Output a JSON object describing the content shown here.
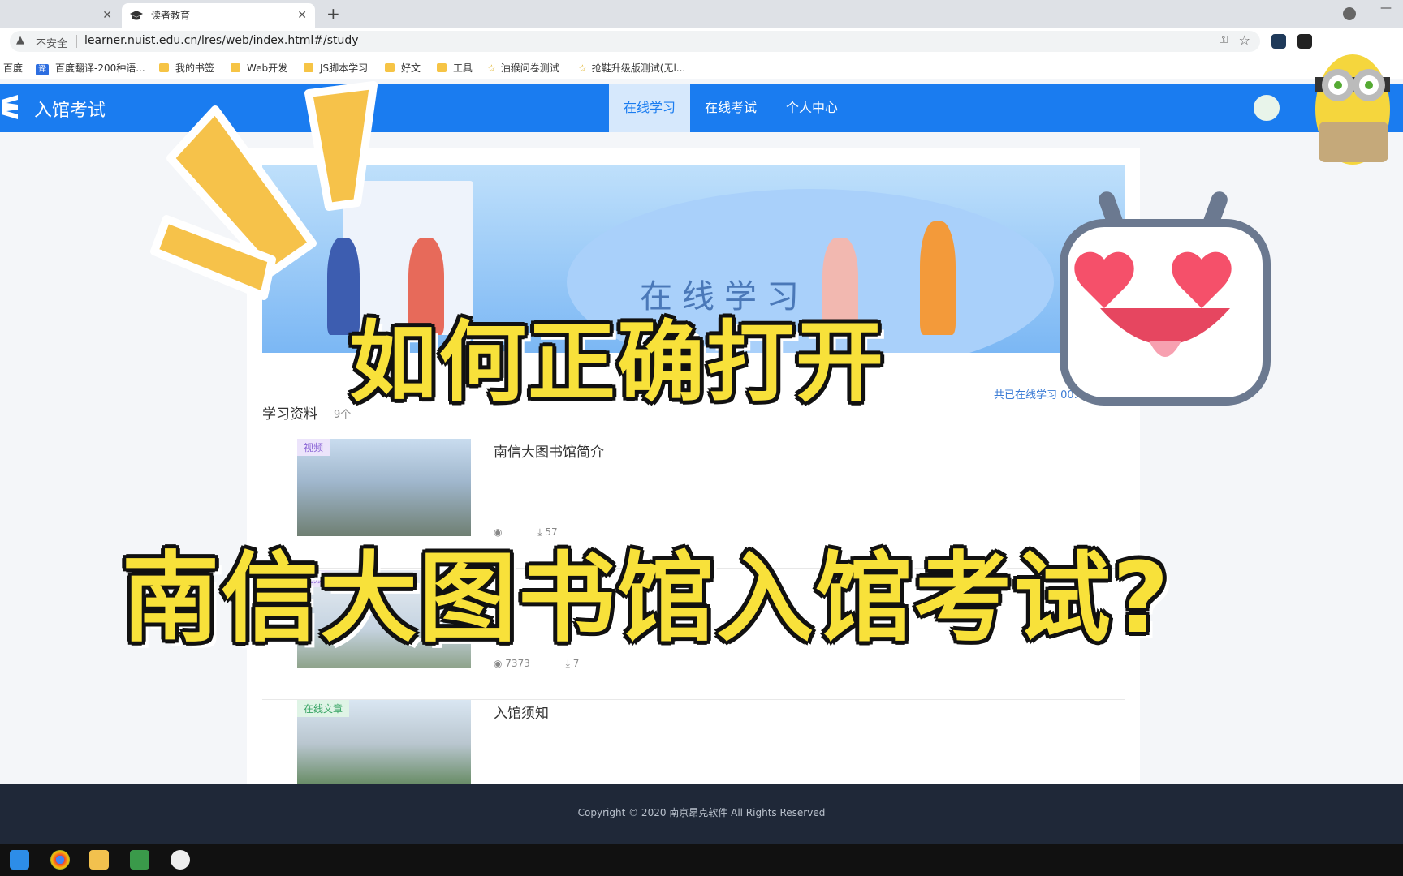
{
  "browser": {
    "tabs": [
      {
        "label": ""
      },
      {
        "label": "读者教育"
      }
    ],
    "omnibox": {
      "security_label": "不安全",
      "url": "learner.nuist.edu.cn/lres/web/index.html#/study"
    },
    "bookmarks": [
      {
        "label": "百度",
        "icon": "none"
      },
      {
        "label": "百度翻译-200种语...",
        "icon": "translate-icon"
      },
      {
        "label": "我的书签",
        "icon": "folder-icon"
      },
      {
        "label": "Web开发",
        "icon": "folder-icon"
      },
      {
        "label": "JS脚本学习",
        "icon": "folder-icon"
      },
      {
        "label": "好文",
        "icon": "folder-icon"
      },
      {
        "label": "工具",
        "icon": "folder-icon"
      },
      {
        "label": "油猴问卷测试",
        "icon": "star-icon"
      },
      {
        "label": "抢鞋升级版测试(无l...",
        "icon": "star-icon"
      }
    ]
  },
  "app": {
    "title": "入馆考试",
    "brand_color": "#1a7cf0",
    "nav": [
      {
        "label": "在线学习",
        "active": true
      },
      {
        "label": "在线考试",
        "active": false
      },
      {
        "label": "个人中心",
        "active": false
      }
    ]
  },
  "banner": {
    "text": "在线学习"
  },
  "study": {
    "section_title": "学习资料",
    "count": "9个",
    "online_time": "共已在线学习 00:",
    "items": [
      {
        "badge": "视频",
        "title": "南信大图书馆简介",
        "views": "",
        "downloads": "57"
      },
      {
        "badge": "视频",
        "title": "",
        "views": "7373",
        "downloads": "7"
      },
      {
        "badge": "在线文章",
        "title": "入馆须知",
        "views": "",
        "downloads": ""
      }
    ]
  },
  "footer": {
    "copyright": "Copyright © 2020 南京昂克软件 All Rights Reserved"
  },
  "overlay": {
    "line1": "如何正确打开",
    "line2": "南信大图书馆入馆考试?"
  }
}
